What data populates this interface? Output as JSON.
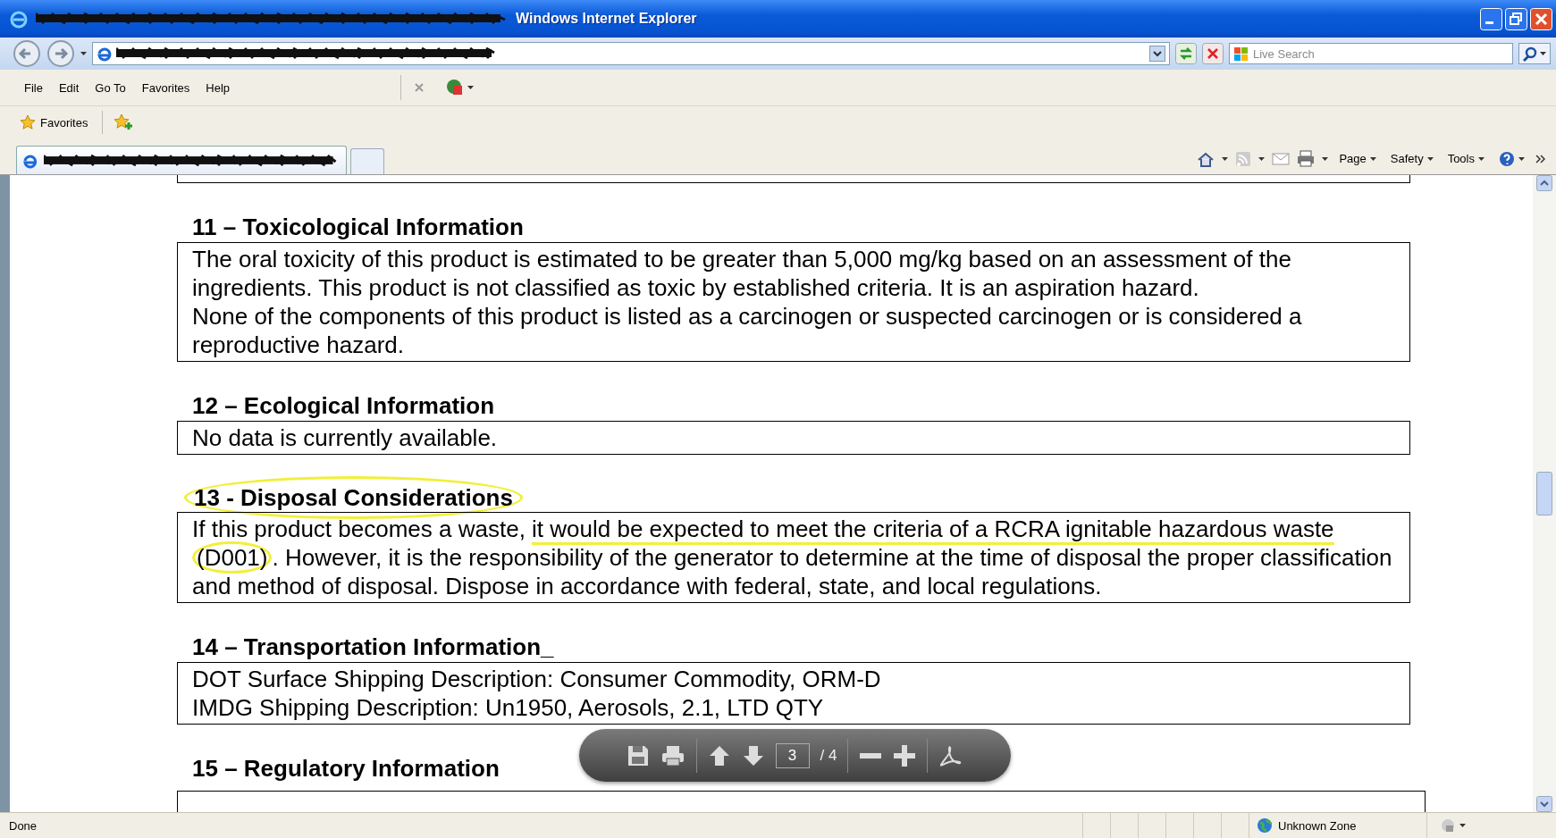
{
  "window": {
    "title": "Windows Internet Explorer"
  },
  "search": {
    "placeholder": "Live Search"
  },
  "menu": [
    "File",
    "Edit",
    "Go To",
    "Favorites",
    "Help"
  ],
  "favorites_bar": {
    "label": "Favorites"
  },
  "command_bar": [
    "Page",
    "Safety",
    "Tools"
  ],
  "document": {
    "sections": [
      {
        "heading": "11 – Toxicological Information",
        "circled": false,
        "paragraphs": [
          [
            {
              "text": "The oral toxicity of this product is estimated to be greater than 5,000 mg/kg based on an assessment of the ingredients. This product is not classified as toxic by established criteria. It is an aspiration hazard.",
              "underlined": false,
              "circled": false
            }
          ],
          [
            {
              "text": "None of the components of this product is listed as a carcinogen or suspected carcinogen or is considered a reproductive hazard.",
              "underlined": false,
              "circled": false
            }
          ]
        ]
      },
      {
        "heading": "12 – Ecological Information",
        "circled": false,
        "paragraphs": [
          [
            {
              "text": "No data is currently available.",
              "underlined": false,
              "circled": false
            }
          ]
        ]
      },
      {
        "heading": "13 - Disposal Considerations",
        "circled": true,
        "paragraphs": [
          [
            {
              "text": "If this product becomes a waste, ",
              "underlined": false,
              "circled": false
            },
            {
              "text": "it would be expected to meet the criteria of a RCRA ignitable hazardous waste ",
              "underlined": true,
              "circled": false
            },
            {
              "text": "(D001)",
              "underlined": false,
              "circled": true
            },
            {
              "text": ". However, it is the responsibility of the generator to determine at the time of disposal the proper classification and method of disposal. Dispose in accordance with federal, state, and local regulations.",
              "underlined": false,
              "circled": false
            }
          ]
        ]
      },
      {
        "heading": "14 – Transportation Information_",
        "circled": false,
        "paragraphs": [
          [
            {
              "text": "DOT Surface Shipping Description: Consumer Commodity, ORM-D",
              "underlined": false,
              "circled": false
            }
          ],
          [
            {
              "text": "IMDG Shipping Description: Un1950, Aerosols, 2.1, LTD QTY",
              "underlined": false,
              "circled": false
            }
          ]
        ]
      },
      {
        "heading": "15 – Regulatory Information",
        "circled": false
      }
    ]
  },
  "pdf_toolbar": {
    "page": "3",
    "total": "/ 4"
  },
  "status_bar": {
    "status": "Done",
    "zone": "Unknown Zone"
  }
}
